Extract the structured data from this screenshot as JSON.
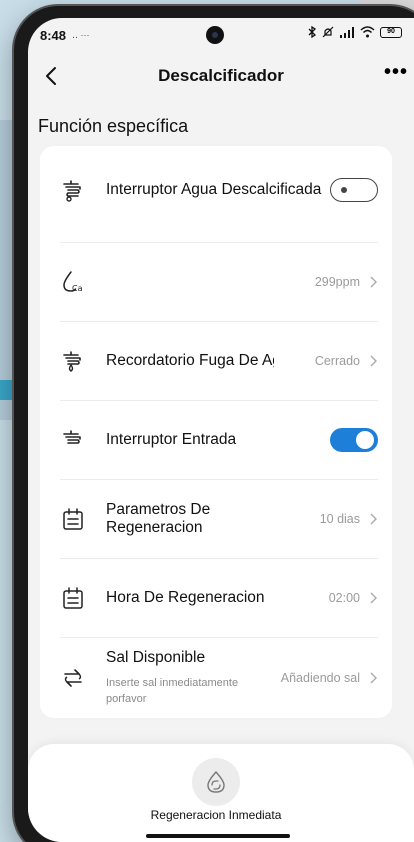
{
  "status": {
    "time": "8:48",
    "extra": "‥ ···",
    "battery": "90"
  },
  "nav": {
    "title": "Descalcificador",
    "back_icon": "chevron-left-icon",
    "more_icon": "more-dots-icon"
  },
  "section_title": "Función específica",
  "rows": [
    {
      "label": "Interruptor Agua Descalcificada",
      "value": "",
      "control": "toggle-off",
      "icon": "faucet-softened-icon"
    },
    {
      "label": "",
      "value": "299ppm",
      "control": "chevron",
      "icon": "calcium-drop-icon"
    },
    {
      "label": "Recordatorio Fuga De Agua",
      "value": "Cerrado",
      "control": "chevron",
      "icon": "faucet-leak-icon"
    },
    {
      "label": "Interruptor Entrada",
      "value": "",
      "control": "toggle-on",
      "icon": "faucet-inlet-icon"
    },
    {
      "label": "Parametros De Regeneracion",
      "value": "10 dias",
      "control": "chevron",
      "icon": "calendar-icon"
    },
    {
      "label": "Hora De Regeneracion",
      "value": "02:00",
      "control": "chevron",
      "icon": "calendar-icon"
    },
    {
      "label": "Sal Disponible",
      "sub": "Inserte sal inmediatamente porfavor",
      "value": "Añadiendo sal",
      "control": "chevron",
      "icon": "salt-cycle-icon"
    }
  ],
  "bottom": {
    "label": "Regeneracion Inmediata",
    "icon": "regenerate-drop-icon"
  },
  "colors": {
    "toggle_on": "#1e7fd8",
    "card_bg": "#ffffff",
    "screen_bg": "#f3f3f3"
  }
}
